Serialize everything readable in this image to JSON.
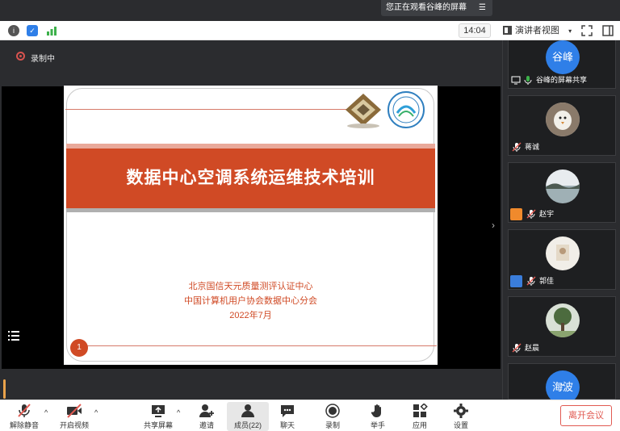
{
  "banner": {
    "sharing_text": "您正在观看谷峰的屏幕",
    "menu_icon": "menu-lines-icon"
  },
  "topbar": {
    "clock": "14:04",
    "view_label": "演讲者视图"
  },
  "recording": {
    "label": "录制中"
  },
  "slide": {
    "title": "数据中心空调系统运维技术培训",
    "org1": "北京国信天元质量测评认证中心",
    "org2": "中国计算机用户协会数据中心分会",
    "date": "2022年7月",
    "page": "1"
  },
  "participants": [
    {
      "name": "谷峰的屏幕共享",
      "avatar_text": "谷峰",
      "avatar_color": "#2f7fe8"
    },
    {
      "name": "蒋诚",
      "avatar_kind": "photo-white-bird"
    },
    {
      "name": "赵宇",
      "avatar_kind": "photo-lake"
    },
    {
      "name": "郭佳",
      "avatar_kind": "photo-room"
    },
    {
      "name": "赵晨",
      "avatar_kind": "photo-tree"
    },
    {
      "name": "",
      "avatar_text": "海波",
      "avatar_color": "#2f7fe8"
    }
  ],
  "toolbar": {
    "unmute": "解除静音",
    "start_video": "开启视频",
    "share_screen": "共享屏幕",
    "invite": "邀请",
    "members": "成员(22)",
    "chat": "聊天",
    "record": "录制",
    "raise_hand": "举手",
    "apps": "应用",
    "settings": "设置",
    "leave": "离开会议"
  },
  "colors": {
    "accent": "#d04a25",
    "leave": "#e15a52",
    "avatar_blue": "#2f7fe8"
  }
}
